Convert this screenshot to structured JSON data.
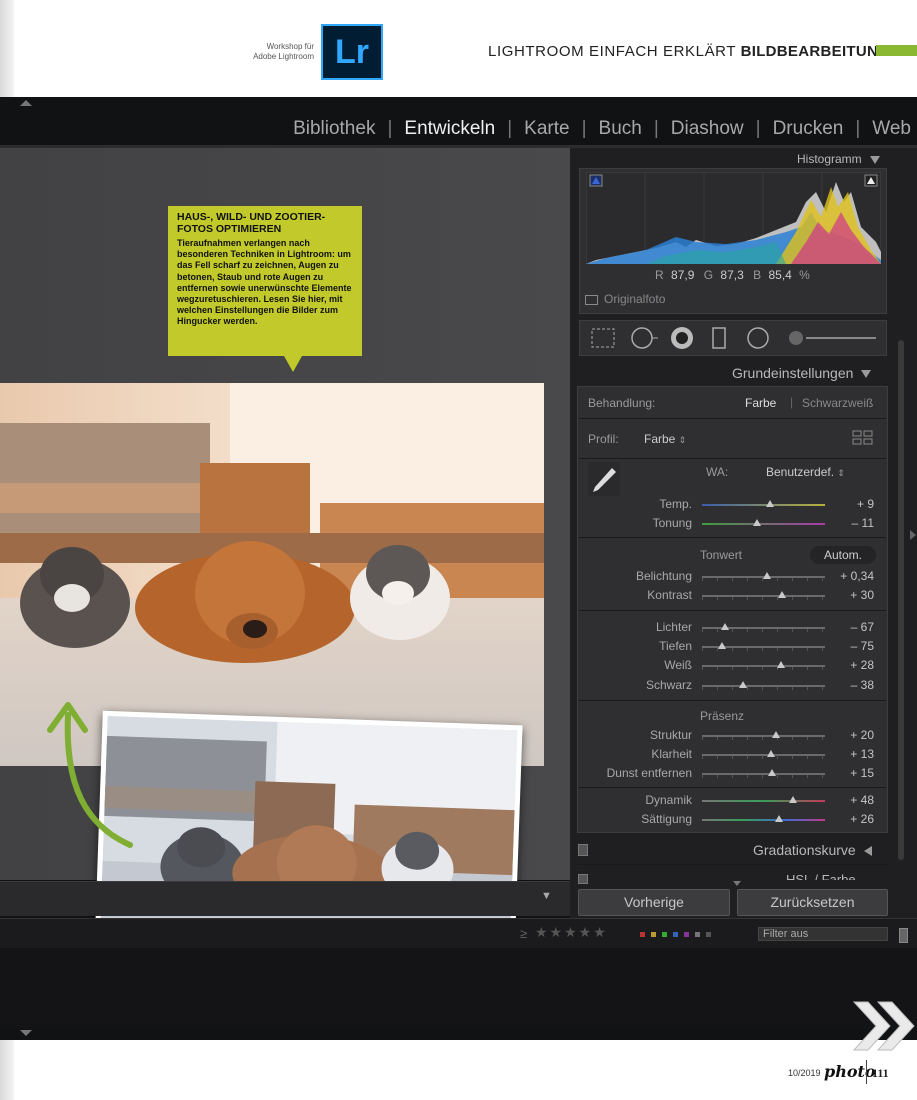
{
  "magazine": {
    "workshop_line1": "Workshop für",
    "workshop_line2": "Adobe Lightroom",
    "logo_text": "Lr",
    "header_title": "LIGHTROOM EINFACH ERKLÄRT",
    "header_title_bold": "BILDBEARBEITUNG",
    "issue": "10/2019",
    "brand": "photo",
    "page_number": "111"
  },
  "modules": [
    "Bibliothek",
    "Entwickeln",
    "Karte",
    "Buch",
    "Diashow",
    "Drucken",
    "Web"
  ],
  "active_module": "Entwickeln",
  "callout": {
    "title": "Haus-, Wild- und Zootier-fotos optimieren",
    "body": "Tieraufnahmen verlangen nach besonderen Techniken in Lightroom: um das Fell scharf zu zeichnen, Augen zu betonen, Staub und rote Augen zu entfernen sowie unerwünschte Elemente wegzuretuschieren. Lesen Sie hier, mit welchen Einstellungen die Bilder zum Hingucker werden."
  },
  "histogram": {
    "title": "Histogramm",
    "r_label": "R",
    "r_value": "87,9",
    "g_label": "G",
    "g_value": "87,3",
    "b_label": "B",
    "b_value": "85,4",
    "unit": "%",
    "original_label": "Originalfoto"
  },
  "basic": {
    "title": "Grundeinstellungen",
    "treatment_label": "Behandlung:",
    "treatment_color": "Farbe",
    "treatment_bw": "Schwarzweiß",
    "profile_label": "Profil:",
    "profile_value": "Farbe",
    "wb_label": "WA:",
    "wb_value": "Benutzerdef.",
    "tone_label": "Tonwert",
    "auto_label": "Autom.",
    "presence_label": "Präsenz"
  },
  "sliders": {
    "temp": {
      "label": "Temp.",
      "value": "+ 9",
      "pos": 0.55
    },
    "tint": {
      "label": "Tonung",
      "value": "– 11",
      "pos": 0.45
    },
    "exposure": {
      "label": "Belichtung",
      "value": "+ 0,34",
      "pos": 0.53
    },
    "contrast": {
      "label": "Kontrast",
      "value": "+ 30",
      "pos": 0.65
    },
    "highlights": {
      "label": "Lichter",
      "value": "– 67",
      "pos": 0.19
    },
    "shadows": {
      "label": "Tiefen",
      "value": "– 75",
      "pos": 0.16
    },
    "whites": {
      "label": "Weiß",
      "value": "+ 28",
      "pos": 0.64
    },
    "blacks": {
      "label": "Schwarz",
      "value": "– 38",
      "pos": 0.33
    },
    "texture": {
      "label": "Struktur",
      "value": "+ 20",
      "pos": 0.6
    },
    "clarity": {
      "label": "Klarheit",
      "value": "+ 13",
      "pos": 0.56
    },
    "dehaze": {
      "label": "Dunst entfernen",
      "value": "+ 15",
      "pos": 0.57
    },
    "vibrance": {
      "label": "Dynamik",
      "value": "+ 48",
      "pos": 0.74
    },
    "saturation": {
      "label": "Sättigung",
      "value": "+ 26",
      "pos": 0.63
    }
  },
  "panels": {
    "tone_curve": "Gradationskurve",
    "hsl": "HSL / Farbe"
  },
  "buttons": {
    "previous": "Vorherige",
    "reset": "Zurücksetzen"
  },
  "filter": {
    "label": "Filter aus",
    "ge_symbol": "≥",
    "stars": "★★★★★"
  },
  "colors": {
    "accent_green": "#8ab833",
    "callout_yellow": "#c1c92b",
    "lr_blue": "#31a8ff",
    "panel_dark": "#1f1f21"
  }
}
